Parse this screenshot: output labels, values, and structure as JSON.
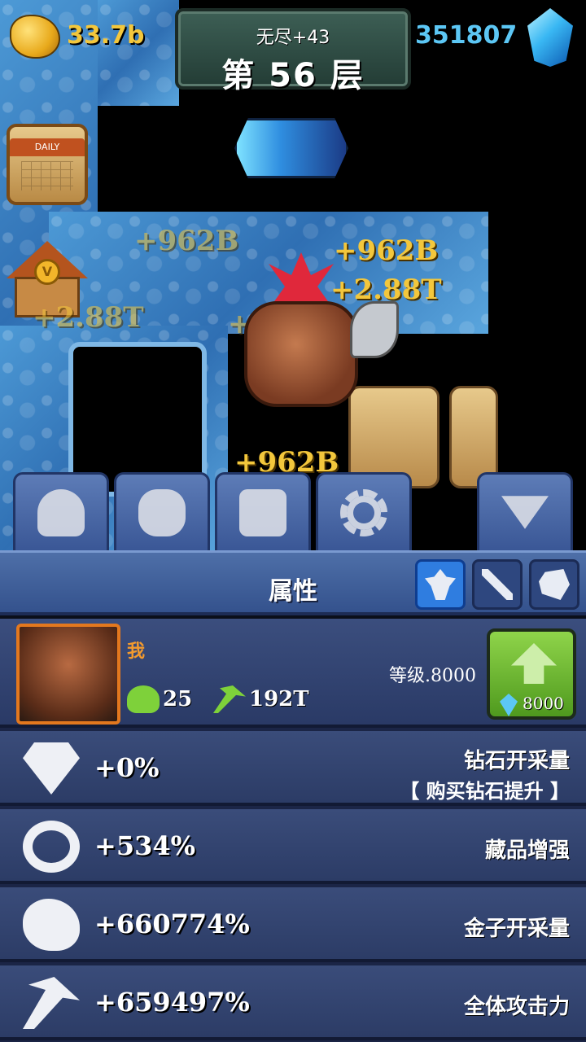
{
  "hud": {
    "gold": "33.7b",
    "gems": "351807",
    "mode": "无尽+43",
    "floor": "第 56 层"
  },
  "side_buttons": {
    "daily_label": "DAILY",
    "shop_coin": "V"
  },
  "floating_numbers": [
    "+962B",
    "+962B",
    "+2.88T",
    "+2.88T",
    "+2.88T",
    "+962B"
  ],
  "tabs": [
    "person-tab",
    "team-tab",
    "chest-tab",
    "settings-tab",
    "collapse-tab"
  ],
  "panel": {
    "title": "属性"
  },
  "player": {
    "name": "我",
    "team_count": "25",
    "attack": "192T",
    "level": "等级.8000",
    "upgrade_cost": "8000"
  },
  "attributes": [
    {
      "icon": "diamond",
      "value": "+0%",
      "label": "钻石开采量",
      "sub": "【 购买钻石提升 】"
    },
    {
      "icon": "ring",
      "value": "+534%",
      "label": "藏品增强"
    },
    {
      "icon": "nugget",
      "value": "+660774%",
      "label": "金子开采量"
    },
    {
      "icon": "pickaxe",
      "value": "+659497%",
      "label": "全体攻击力"
    }
  ],
  "colors": {
    "gold_text": "#f3c73c",
    "gem_text": "#5cc7f5",
    "accent_tab": "#2f7de0",
    "upgrade_green": "#6bb52c",
    "name_orange": "#f29a2e"
  }
}
